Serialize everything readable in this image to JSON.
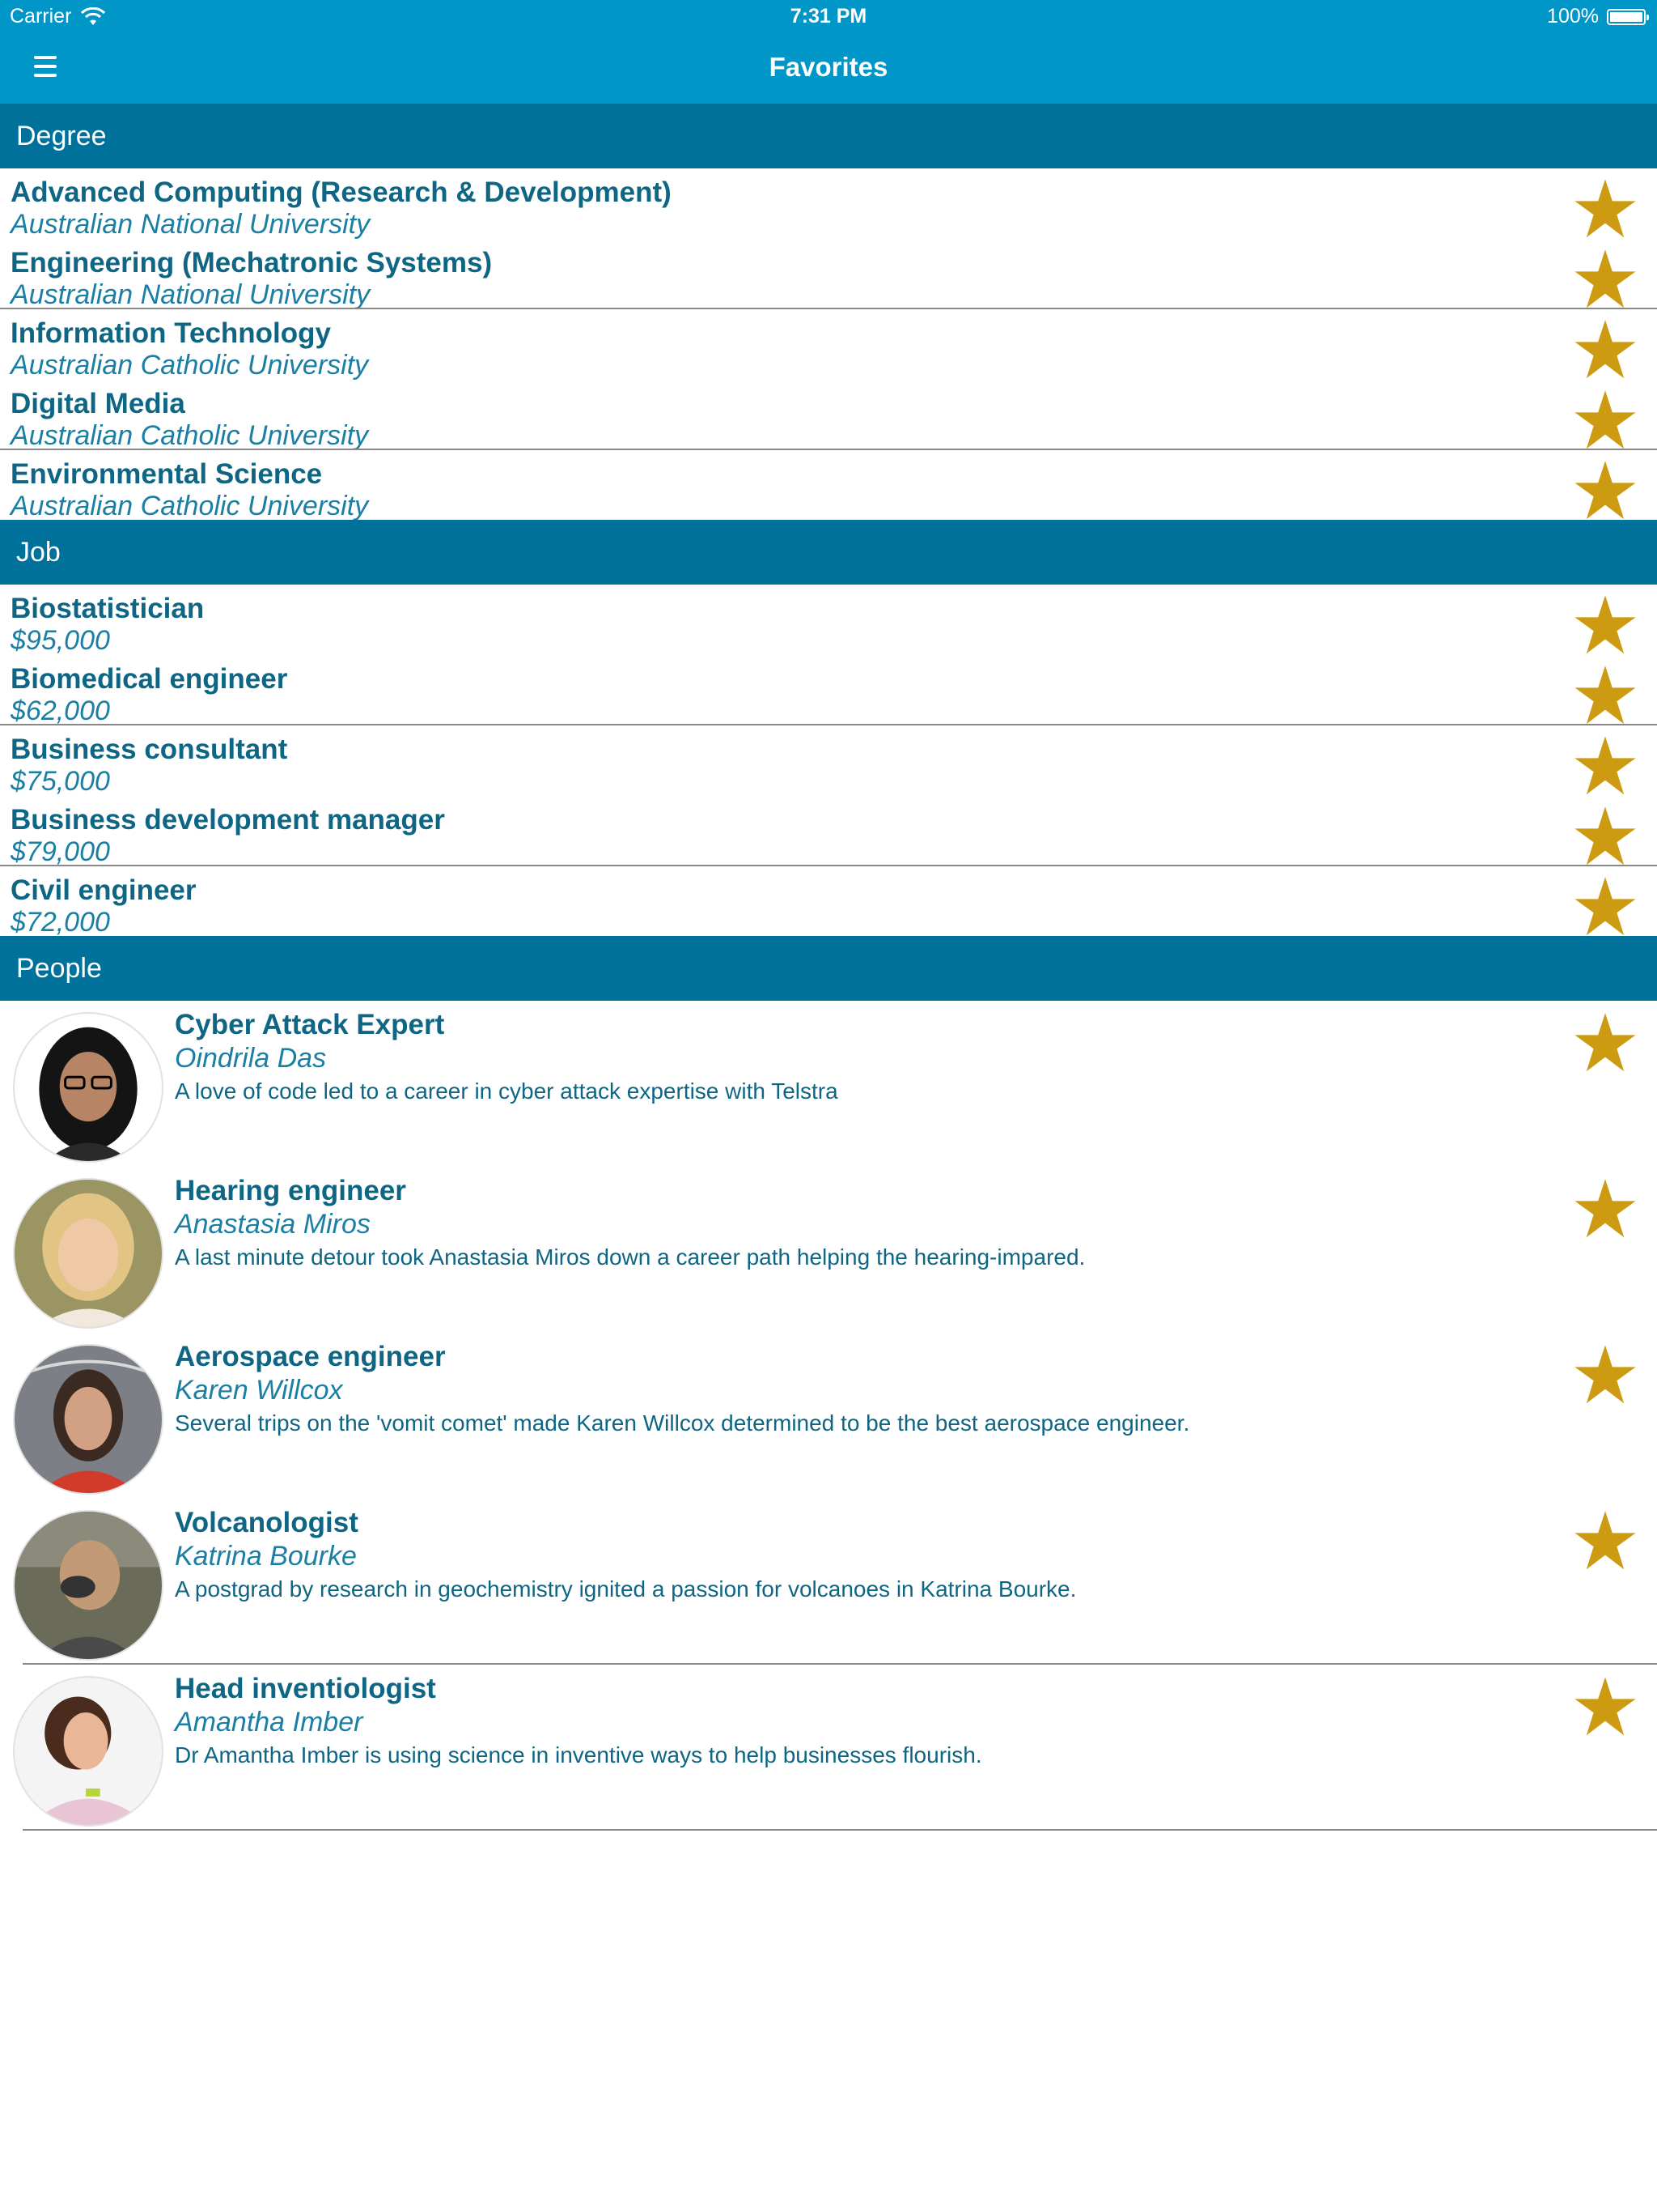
{
  "status_bar": {
    "carrier": "Carrier",
    "time": "7:31 PM",
    "battery": "100%",
    "battery_level": 1.0
  },
  "nav": {
    "menu_icon": "hamburger-menu-icon",
    "title": "Favorites"
  },
  "colors": {
    "nav_bg": "#0096c8",
    "section_bg": "#00719a",
    "title_text": "#0e6684",
    "subtitle_text": "#1b7fa4",
    "star": "#cc9b12"
  },
  "sections": {
    "degree": {
      "header": "Degree",
      "items": [
        {
          "title": "Advanced Computing (Research & Development)",
          "subtitle": "Australian National University"
        },
        {
          "title": "Engineering (Mechatronic Systems)",
          "subtitle": "Australian National University"
        },
        {
          "title": "Information Technology",
          "subtitle": "Australian Catholic University"
        },
        {
          "title": "Digital Media",
          "subtitle": "Australian Catholic University"
        },
        {
          "title": "Environmental Science",
          "subtitle": "Australian Catholic University"
        }
      ]
    },
    "job": {
      "header": "Job",
      "items": [
        {
          "title": "Biostatistician",
          "subtitle": "$95,000"
        },
        {
          "title": "Biomedical engineer",
          "subtitle": "$62,000"
        },
        {
          "title": "Business consultant",
          "subtitle": "$75,000"
        },
        {
          "title": "Business development manager",
          "subtitle": "$79,000"
        },
        {
          "title": "Civil engineer",
          "subtitle": "$72,000"
        }
      ]
    },
    "people": {
      "header": "People",
      "items": [
        {
          "title": "Cyber Attack Expert",
          "name": "Oindrila Das",
          "description": "A love of code led to a career in cyber attack expertise with Telstra"
        },
        {
          "title": "Hearing engineer",
          "name": "Anastasia Miros",
          "description": "A last minute detour took Anastasia Miros down a career path helping the hearing-impared."
        },
        {
          "title": "Aerospace engineer",
          "name": "Karen Willcox",
          "description": "Several trips on the 'vomit comet' made Karen Willcox determined to be the best aerospace engineer."
        },
        {
          "title": "Volcanologist",
          "name": "Katrina Bourke",
          "description": "A postgrad by research in geochemistry ignited a passion for volcanoes in Katrina Bourke."
        },
        {
          "title": "Head inventiologist",
          "name": "Amantha Imber",
          "description": "Dr Amantha Imber is using science in inventive ways to help businesses flourish."
        }
      ]
    }
  }
}
